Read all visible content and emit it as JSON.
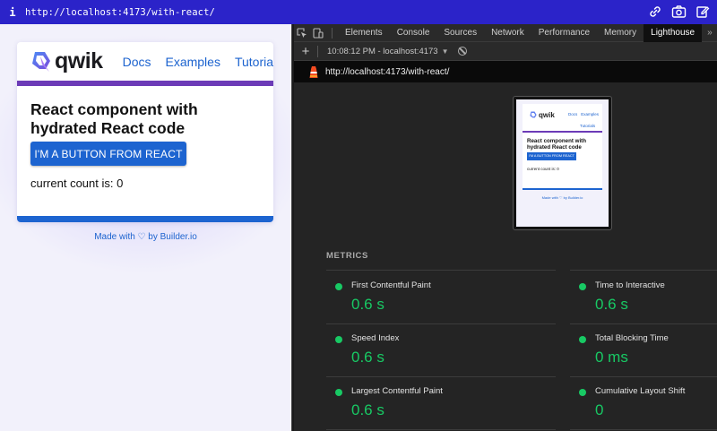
{
  "browser": {
    "info_glyph": "i",
    "url": "http://localhost:4173/with-react/"
  },
  "app": {
    "logo_text": "qwik",
    "nav": [
      "Docs",
      "Examples",
      "Tutorials"
    ],
    "heading": "React component with hydrated React code",
    "button_label": "I'M A BUTTON FROM REACT",
    "count_text": "current count is: 0",
    "footer": "Made with ♡ by Builder.io"
  },
  "devtools": {
    "tabs": [
      "Elements",
      "Console",
      "Sources",
      "Network",
      "Performance",
      "Memory",
      "Lighthouse"
    ],
    "active_tab": "Lighthouse",
    "more_glyph": "»",
    "toolbar": {
      "add_glyph": "+",
      "report": "10:08:12 PM - localhost:4173",
      "caret_glyph": "▼"
    },
    "report_url": "http://localhost:4173/with-react/",
    "thumbnail": {
      "logo_text": "qwik",
      "nav": [
        "Docs",
        "Examples"
      ],
      "nav_overflow": "Tutorials",
      "heading": "React component with hydrated React code",
      "button_label": "I'M A BUTTON FROM REACT",
      "count_text": "current count is: 0",
      "footer": "Made with ♡ by Builder.io"
    },
    "metrics_title": "METRICS",
    "metrics": [
      {
        "label": "First Contentful Paint",
        "value": "0.6 s",
        "status_color": "#18c964"
      },
      {
        "label": "Time to Interactive",
        "value": "0.6 s",
        "status_color": "#18c964"
      },
      {
        "label": "Speed Index",
        "value": "0.6 s",
        "status_color": "#18c964"
      },
      {
        "label": "Total Blocking Time",
        "value": "0 ms",
        "status_color": "#18c964"
      },
      {
        "label": "Largest Contentful Paint",
        "value": "0.6 s",
        "status_color": "#18c964"
      },
      {
        "label": "Cumulative Layout Shift",
        "value": "0",
        "status_color": "#18c964"
      }
    ]
  },
  "colors": {
    "url_bar": "#2b23c9",
    "qwik_blue": "#1d64d0",
    "qwik_purple": "#6c3bb7",
    "metric_good": "#18c964"
  }
}
